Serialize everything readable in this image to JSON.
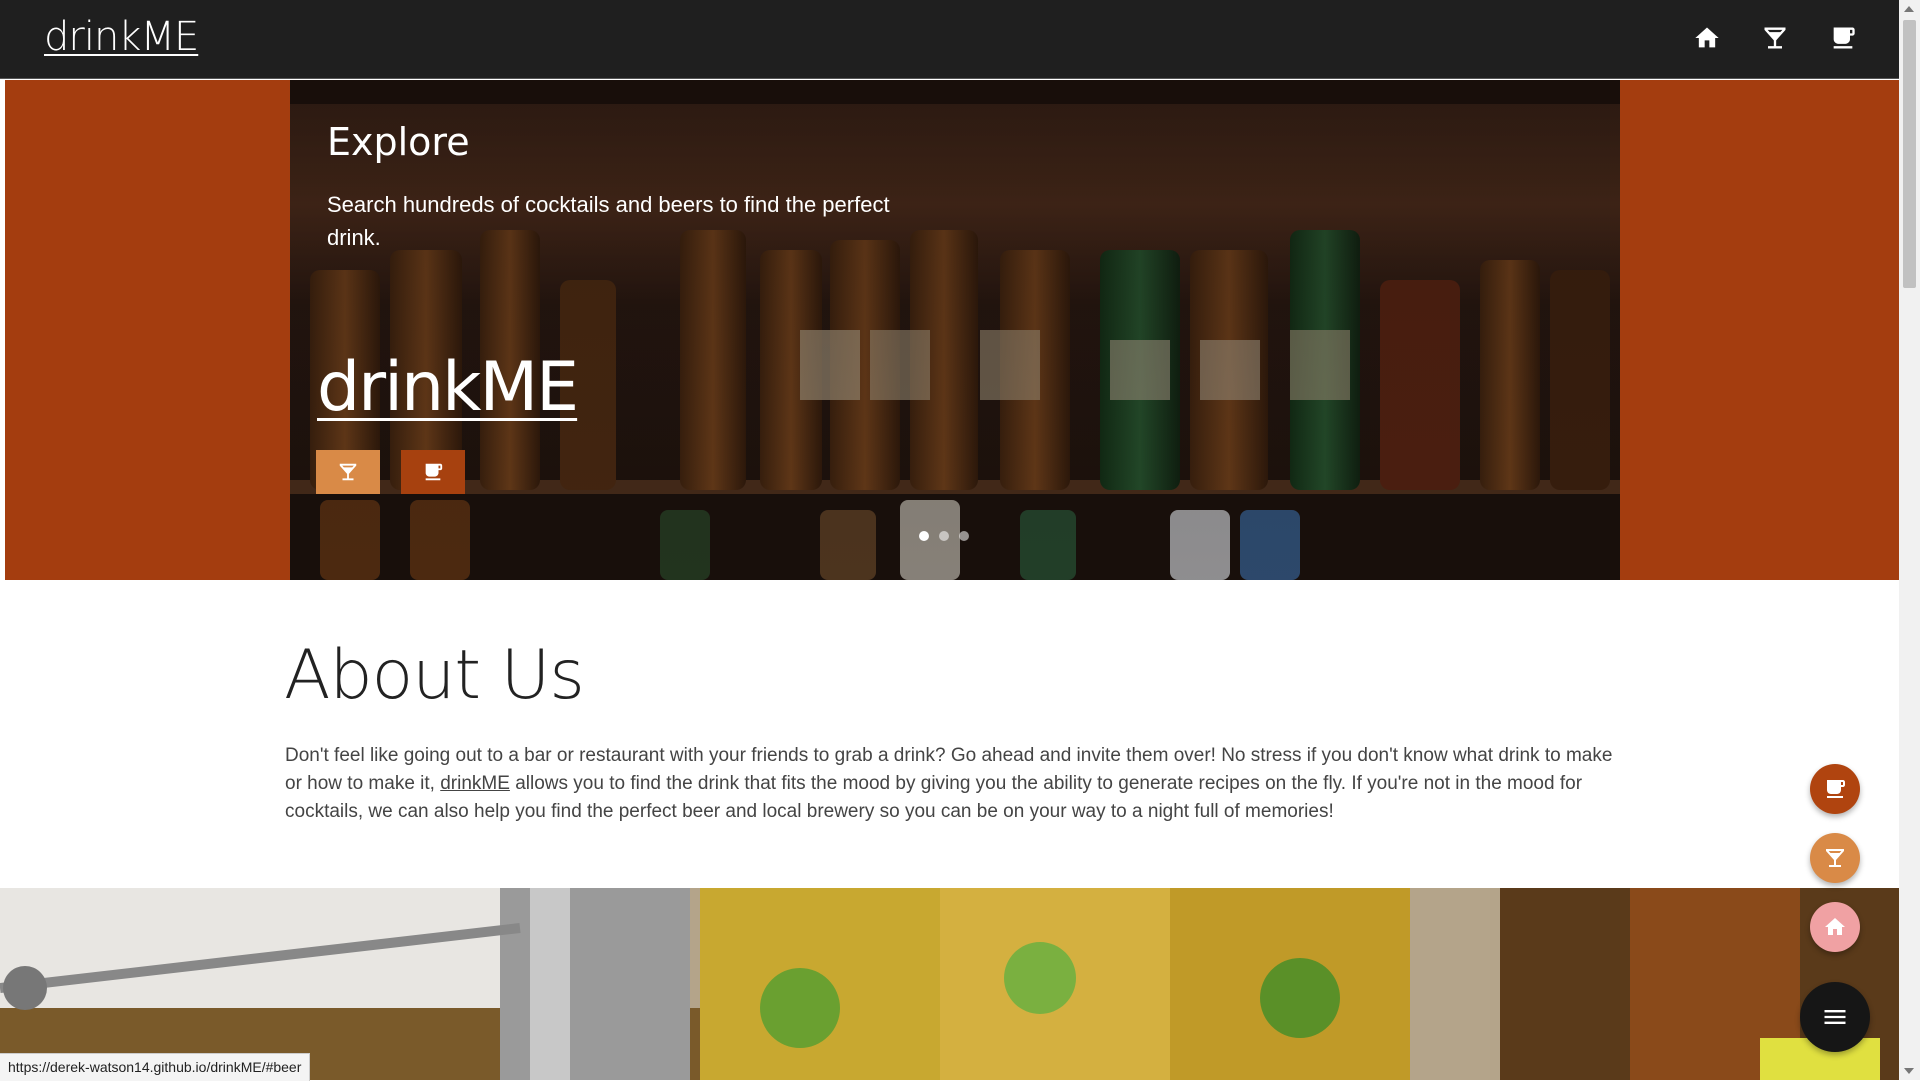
{
  "navbar": {
    "brand": "drinkME",
    "icons": [
      "home-icon",
      "cocktail-icon",
      "beer-icon"
    ]
  },
  "hero": {
    "title": "Explore",
    "description": "Search hundreds of cocktails and beers to find the perfect drink.",
    "brand": "drinkME",
    "buttons": [
      "cocktail-icon",
      "beer-icon"
    ],
    "slide_count": 3,
    "active_slide": 1
  },
  "about": {
    "title": "About Us",
    "text_before": "Don't feel like going out to a bar or restaurant with your friends to grab a drink? Go ahead and invite them over! No stress if you don't know what drink to make or how to make it, ",
    "link": "drinkME",
    "text_after": " allows you to find the drink that fits the mood by giving you the ability to generate recipes on the fly. If you're not in the mood for cocktails, we can also help you find the perfect beer and local brewery so you can be on your way to a night full of memories!"
  },
  "fab": {
    "buttons": [
      "beer-icon",
      "cocktail-icon",
      "home-icon",
      "menu-icon"
    ]
  },
  "status_bar": {
    "url": "https://derek-watson14.github.io/drinkME/#beer"
  },
  "colors": {
    "navbar": "#1f1f1f",
    "hero_band": "#a43d0f",
    "accent_light": "#d98a47",
    "accent_dark": "#a7410f",
    "home_fab": "#f0a1a3"
  }
}
